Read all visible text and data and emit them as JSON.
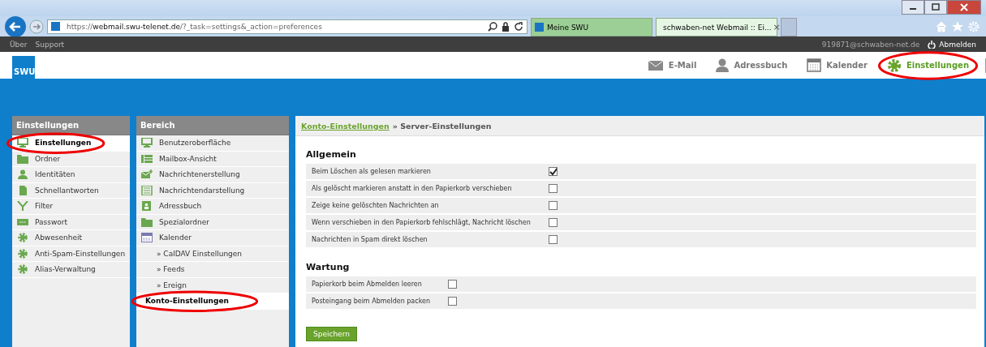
{
  "browser": {
    "address": "https://**webmail.swu-telenet.de**/?_task=settings&_action=preferences",
    "tabs": [
      {
        "label": "Meine SWU",
        "selected": false
      },
      {
        "label": "schwaben-net Webmail :: Ei...",
        "selected": true,
        "close": "×"
      }
    ]
  },
  "topbar": {
    "links": [
      "Über",
      "Support"
    ],
    "user": "919871@schwaben-net.de",
    "logout": "Abmelden"
  },
  "logo": "SWU",
  "nav": [
    {
      "label": "E-Mail",
      "selected": false,
      "circled": false
    },
    {
      "label": "Adressbuch",
      "selected": false,
      "circled": false
    },
    {
      "label": "Kalender",
      "selected": false,
      "circled": false
    },
    {
      "label": "Einstellungen",
      "selected": true,
      "circled": true
    }
  ],
  "sections": {
    "title": "Einstellungen",
    "items": [
      {
        "label": "Einstellungen",
        "selected": true,
        "circled": true
      },
      {
        "label": "Ordner",
        "selected": false,
        "circled": false
      },
      {
        "label": "Identitäten",
        "selected": false,
        "circled": false
      },
      {
        "label": "Schnellantworten",
        "selected": false,
        "circled": false
      },
      {
        "label": "Filter",
        "selected": false,
        "circled": false
      },
      {
        "label": "Passwort",
        "selected": false,
        "circled": false
      },
      {
        "label": "Abwesenheit",
        "selected": false,
        "circled": false
      },
      {
        "label": "Anti-Spam-Einstellungen",
        "selected": false,
        "circled": false
      },
      {
        "label": "Alias-Verwaltung",
        "selected": false,
        "circled": false
      }
    ]
  },
  "area": {
    "title": "Bereich",
    "items": [
      {
        "label": "Benutzeroberfläche",
        "kind": "icon",
        "selected": false,
        "circled": false
      },
      {
        "label": "Mailbox-Ansicht",
        "kind": "icon",
        "selected": false,
        "circled": false
      },
      {
        "label": "Nachrichtenerstellung",
        "kind": "icon",
        "selected": false,
        "circled": false
      },
      {
        "label": "Nachrichtendarstellung",
        "kind": "icon",
        "selected": false,
        "circled": false
      },
      {
        "label": "Adressbuch",
        "kind": "icon",
        "selected": false,
        "circled": false
      },
      {
        "label": "Spezialordner",
        "kind": "icon",
        "selected": false,
        "circled": false
      },
      {
        "label": "Kalender",
        "kind": "icon",
        "selected": false,
        "circled": false
      },
      {
        "label": "» CalDAV Einstellungen",
        "kind": "sub",
        "selected": false,
        "circled": false
      },
      {
        "label": "» Feeds",
        "kind": "sub",
        "selected": false,
        "circled": false
      },
      {
        "label": "» Ereign",
        "kind": "sub",
        "selected": false,
        "circled": false
      },
      {
        "label": "Konto-Einstellungen",
        "kind": "plain",
        "selected": true,
        "circled": true
      }
    ]
  },
  "main": {
    "breadcrumb_link": "Konto-Einstellungen",
    "breadcrumb_current": "» Server-Einstellungen",
    "groups": [
      {
        "title": "Allgemein",
        "options": [
          {
            "label": "Beim Löschen als gelesen markieren",
            "checked": true
          },
          {
            "label": "Als gelöscht markieren anstatt in den Papierkorb verschieben",
            "checked": false
          },
          {
            "label": "Zeige keine gelöschten Nachrichten an",
            "checked": false
          },
          {
            "label": "Wenn verschieben in den Papierkorb fehlschlägt, Nachricht löschen",
            "checked": false
          },
          {
            "label": "Nachrichten in Spam direkt löschen",
            "checked": false
          }
        ]
      },
      {
        "title": "Wartung",
        "options": [
          {
            "label": "Papierkorb beim Abmelden leeren",
            "checked": false
          },
          {
            "label": "Posteingang beim Abmelden packen",
            "checked": false
          }
        ]
      }
    ],
    "save": "Speichern"
  }
}
